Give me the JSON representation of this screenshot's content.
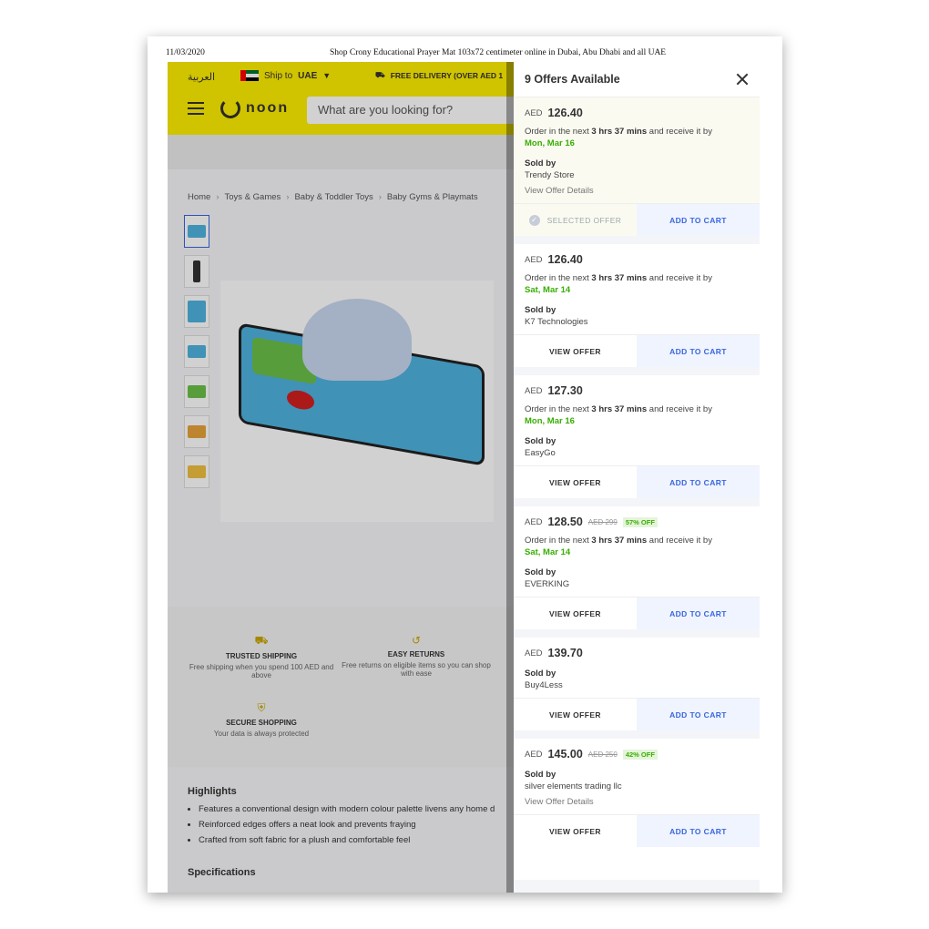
{
  "print_header": {
    "date": "11/03/2020",
    "title": "Shop Crony Educational Prayer Mat 103x72 centimeter online in Dubai, Abu Dhabi and all UAE"
  },
  "topbar": {
    "arabic": "العربية",
    "ship_prefix": "Ship to",
    "ship_country": "UAE",
    "free_delivery": "FREE DELIVERY (OVER AED 1",
    "logo": "noon",
    "search_placeholder": "What are you looking for?"
  },
  "breadcrumb": [
    "Home",
    "Toys & Games",
    "Baby & Toddler Toys",
    "Baby Gyms & Playmats"
  ],
  "trust": {
    "shipping_title": "TRUSTED SHIPPING",
    "shipping_text": "Free shipping when you spend 100 AED and above",
    "returns_title": "EASY RETURNS",
    "returns_text": "Free returns on eligible items so you can shop with ease",
    "secure_title": "SECURE SHOPPING",
    "secure_text": "Your data is always protected"
  },
  "highlights": {
    "title": "Highlights",
    "items": [
      "Features a conventional design with modern colour palette livens any home d",
      "Reinforced edges offers a neat look and prevents fraying",
      "Crafted from soft fabric for a plush and comfortable feel"
    ]
  },
  "specs_title": "Specifications",
  "panel": {
    "title": "9 Offers Available",
    "currency": "AED",
    "delivery_prefix": "Order in the next",
    "delivery_time": "3 hrs 37 mins",
    "delivery_suffix": "and receive it by",
    "sold_by_label": "Sold by",
    "view_offer_details": "View Offer Details",
    "view_offer": "VIEW OFFER",
    "add_to_cart": "ADD TO CART",
    "selected_offer": "SELECTED OFFER",
    "offers": [
      {
        "price": "126.40",
        "date": "Mon, Mar 16",
        "seller": "Trendy Store"
      },
      {
        "price": "126.40",
        "date": "Sat, Mar 14",
        "seller": "K7 Technologies"
      },
      {
        "price": "127.30",
        "date": "Mon, Mar 16",
        "seller": "EasyGo"
      },
      {
        "price": "128.50",
        "old": "AED 299",
        "off": "57% OFF",
        "date": "Sat, Mar 14",
        "seller": "EVERKING"
      },
      {
        "price": "139.70",
        "seller": "Buy4Less"
      },
      {
        "price": "145.00",
        "old": "AED 250",
        "off": "42% OFF",
        "seller": "silver elements trading llc"
      }
    ]
  }
}
